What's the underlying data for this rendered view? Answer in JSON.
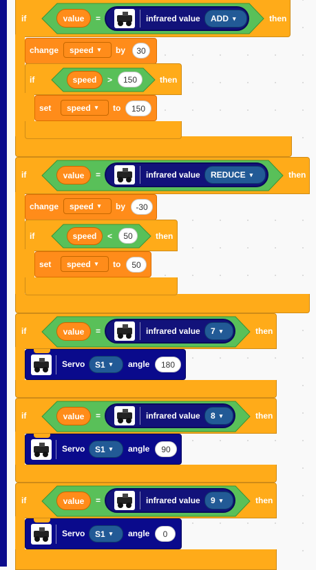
{
  "colors": {
    "control": "#ffab19",
    "variables": "#ff8c1a",
    "operators": "#59c059",
    "sensor": "#12127a",
    "servo": "#0a0a8c",
    "dropdown_blue": "#225a96"
  },
  "keywords": {
    "if": "if",
    "then": "then",
    "change": "change",
    "by": "by",
    "set": "set",
    "to": "to",
    "servo": "Servo",
    "angle": "angle",
    "infrared": "infrared value"
  },
  "blocks": [
    {
      "variable": "value",
      "operator": "=",
      "button": "ADD",
      "change_var": "speed",
      "change_by": "30",
      "inner_var": "speed",
      "inner_op": ">",
      "inner_value": "150",
      "set_var": "speed",
      "set_to": "150"
    },
    {
      "variable": "value",
      "operator": "=",
      "button": "REDUCE",
      "change_var": "speed",
      "change_by": "-30",
      "inner_var": "speed",
      "inner_op": "<",
      "inner_value": "50",
      "set_var": "speed",
      "set_to": "50"
    },
    {
      "variable": "value",
      "operator": "=",
      "button": "7",
      "servo_port": "S1",
      "angle": "180"
    },
    {
      "variable": "value",
      "operator": "=",
      "button": "8",
      "servo_port": "S1",
      "angle": "90"
    },
    {
      "variable": "value",
      "operator": "=",
      "button": "9",
      "servo_port": "S1",
      "angle": "0"
    }
  ],
  "icons": {
    "caret": "▾",
    "robot": "robot-car-icon"
  }
}
